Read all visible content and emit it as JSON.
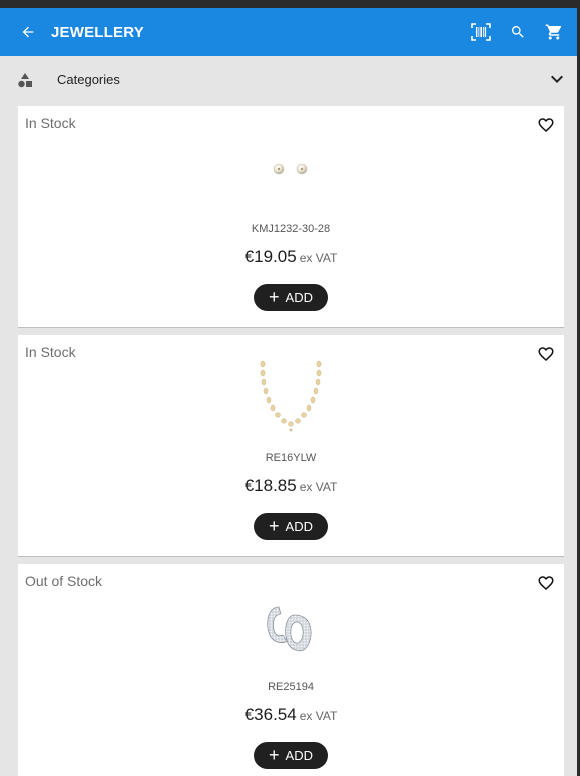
{
  "header": {
    "title": "JEWELLERY"
  },
  "categories": {
    "label": "Categories"
  },
  "products": [
    {
      "stock": "In Stock",
      "sku": "KMJ1232-30-28",
      "price": "€19.05",
      "vat": "ex VAT",
      "add_label": "ADD"
    },
    {
      "stock": "In Stock",
      "sku": "RE16YLW",
      "price": "€18.85",
      "vat": "ex VAT",
      "add_label": "ADD"
    },
    {
      "stock": "Out of Stock",
      "sku": "RE25194",
      "price": "€36.54",
      "vat": "ex VAT",
      "add_label": "ADD"
    }
  ],
  "colors": {
    "appbar": "#1a87e0",
    "button": "#202020",
    "background": "#e5e5e5"
  }
}
